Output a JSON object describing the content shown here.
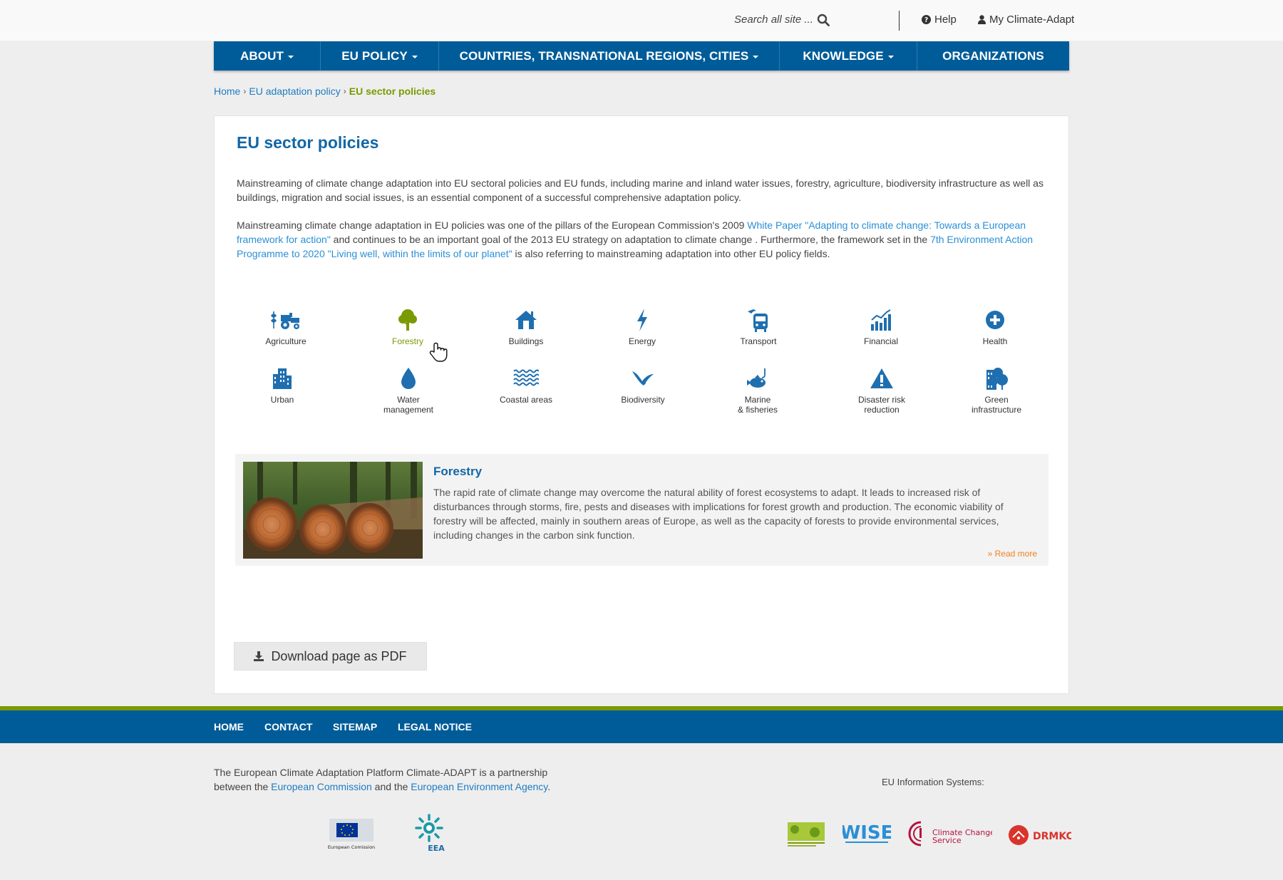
{
  "header": {
    "search_placeholder": "Search all site ...",
    "help_label": "Help",
    "account_label": "My Climate-Adapt"
  },
  "nav": {
    "items": [
      {
        "label": "ABOUT",
        "dropdown": true
      },
      {
        "label": "EU POLICY",
        "dropdown": true
      },
      {
        "label": "COUNTRIES, TRANSNATIONAL REGIONS, CITIES",
        "dropdown": true
      },
      {
        "label": "KNOWLEDGE",
        "dropdown": true
      },
      {
        "label": "ORGANIZATIONS",
        "dropdown": false
      }
    ]
  },
  "breadcrumb": {
    "home": "Home",
    "parent": "EU adaptation policy",
    "current": "EU sector policies",
    "separator": "›"
  },
  "page": {
    "title": "EU sector policies",
    "paragraph1": "Mainstreaming of climate change adaptation into EU sectoral policies and EU funds, including marine and inland water issues, forestry, agriculture, biodiversity infrastructure as well as buildings, migration and social issues, is an essential component of a successful comprehensive adaptation policy.",
    "p2_part1": "Mainstreaming climate change adaptation in EU policies was one of the pillars of the European Commission's 2009 ",
    "p2_link1": "White Paper \"Adapting to climate change: Towards a European framework for action\"",
    "p2_part2": " and continues to be an important goal of the 2013 EU strategy on adaptation to climate change . Furthermore, the framework set in the ",
    "p2_link2": "7th Environment Action Programme to 2020 \"Living well, within the limits of our planet\"",
    "p2_part3": " is also referring to mainstreaming adaptation into other EU policy fields."
  },
  "sectors": {
    "agriculture": "Agriculture",
    "forestry": "Forestry",
    "buildings": "Buildings",
    "energy": "Energy",
    "transport": "Transport",
    "financial": "Financial",
    "health": "Health",
    "urban": "Urban",
    "water_l1": "Water",
    "water_l2": "management",
    "coastal": "Coastal areas",
    "biodiversity": "Biodiversity",
    "marine_l1": "Marine",
    "marine_l2": "& fisheries",
    "disaster_l1": "Disaster risk",
    "disaster_l2": "reduction",
    "green_l1": "Green",
    "green_l2": "infrastructure",
    "active": "Forestry"
  },
  "featured": {
    "title": "Forestry",
    "text": "The rapid rate of climate change may overcome the natural ability of forest ecosystems to adapt. It leads to increased risk of disturbances through storms, fire, pests and diseases with implications for forest growth and production. The economic viability of forestry will be affected, mainly in southern areas of Europe, as well as the capacity of forests to provide environmental services, including changes in the carbon sink function.",
    "read_more": "» Read more"
  },
  "download": {
    "label": "Download page as PDF"
  },
  "footer": {
    "nav": [
      "HOME",
      "CONTACT",
      "SITEMAP",
      "LEGAL NOTICE"
    ],
    "partnership_part1": "The European Climate Adaptation Platform Climate-ADAPT is a partnership between the ",
    "link_ec": "European Commission",
    "partnership_part2": " and the ",
    "link_eea": "European Environment Agency",
    "partnership_part3": ".",
    "eu_info": "EU Information Systems:",
    "logo_ec": "European Comission",
    "logo_eea": "EEA",
    "logo_wise": "WISE",
    "logo_ccs_l1": "Climate Change",
    "logo_ccs_l2": "Service",
    "logo_drmkc": "DRMKC"
  },
  "colors": {
    "nav_blue": "#005c99",
    "title_blue": "#1167a6",
    "link_blue": "#2a8fd6",
    "green_accent": "#7a9a01",
    "read_more_orange": "#f0801e"
  }
}
